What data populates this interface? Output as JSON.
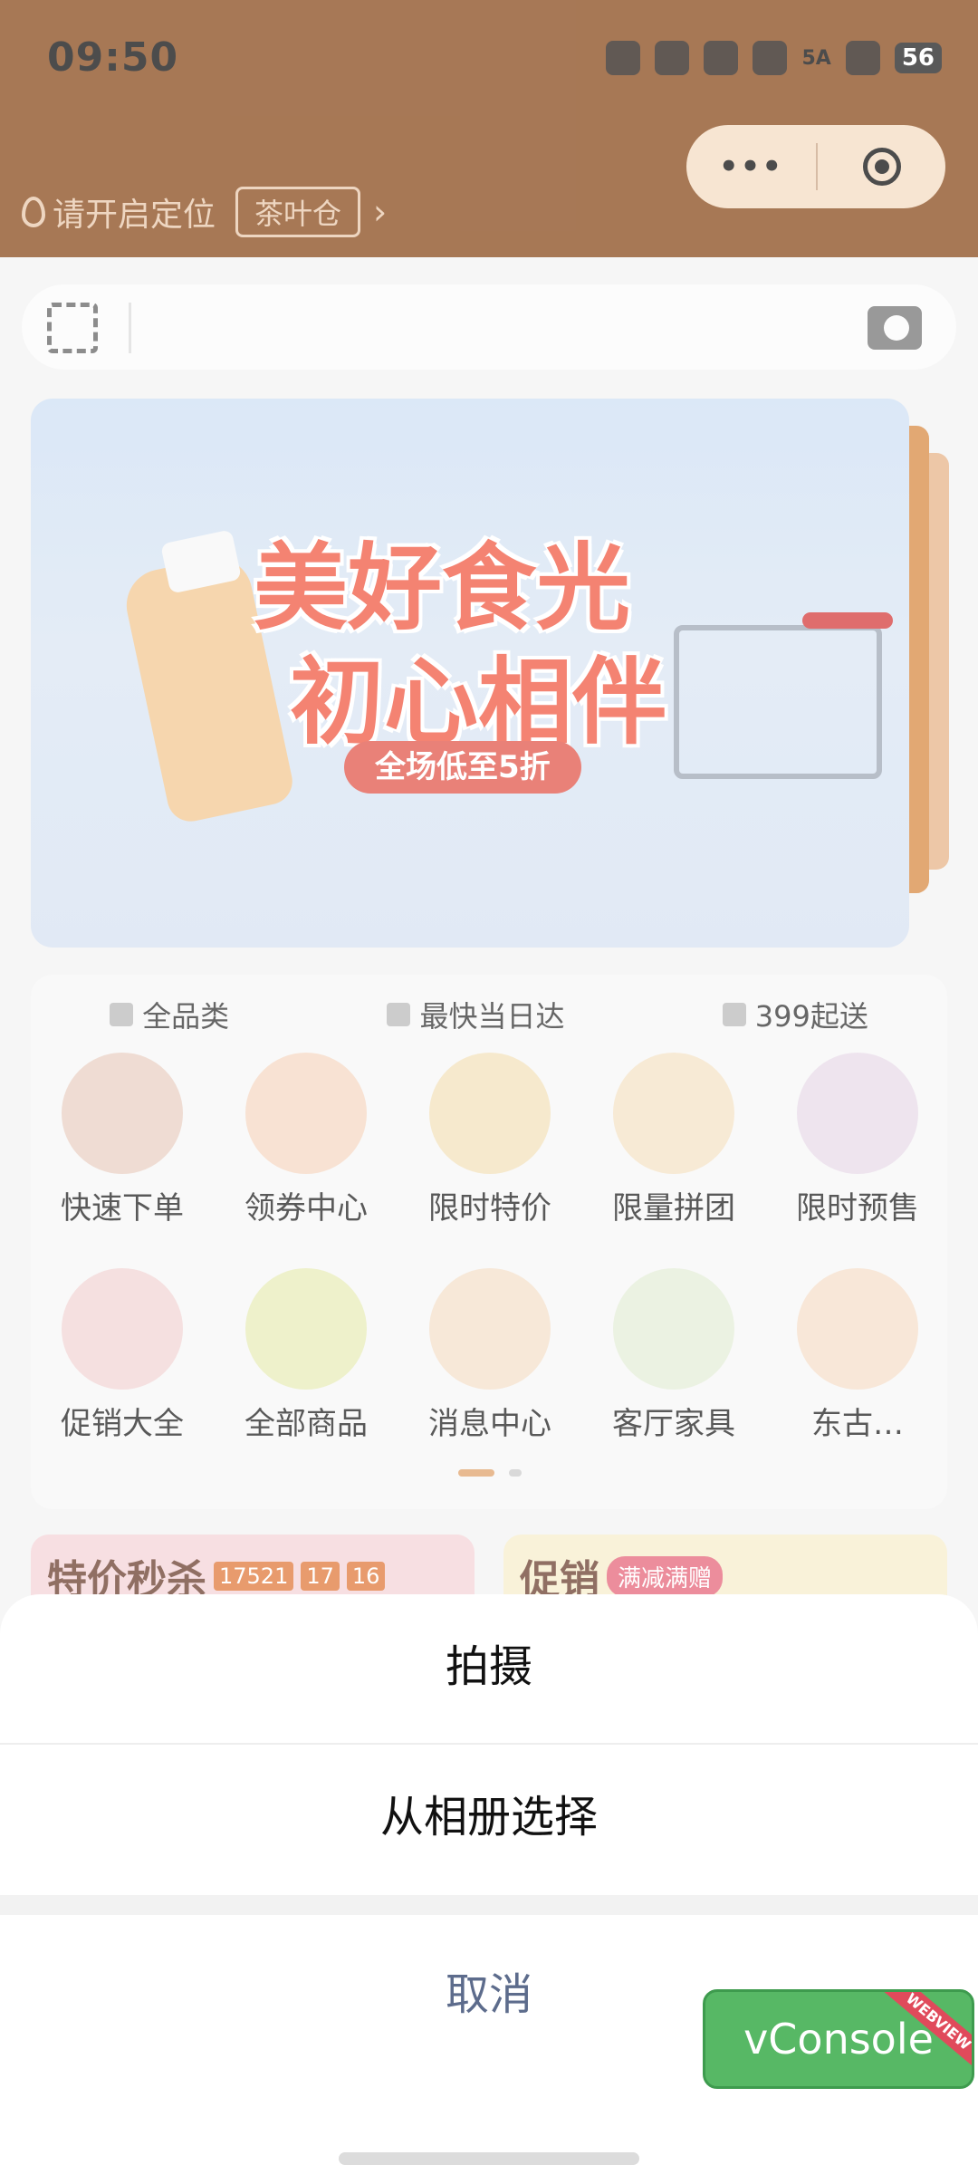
{
  "status_bar": {
    "time": "09:50",
    "network": "5A",
    "battery": "56"
  },
  "header": {
    "location_text": "请开启定位",
    "store_tag": "茶叶仓",
    "capsule_more": "•••",
    "chevron": "›"
  },
  "banner": {
    "line1": "美好食光",
    "line2": "初心相伴",
    "pill": "全场低至5折"
  },
  "features": [
    {
      "label": "全品类",
      "icon": "grid-icon"
    },
    {
      "label": "最快当日达",
      "icon": "rocket-icon"
    },
    {
      "label": "399起送",
      "icon": "truck-icon"
    }
  ],
  "grid_items": [
    {
      "label": "快速下单",
      "color": "#ead1c4"
    },
    {
      "label": "领券中心",
      "color": "#f6d9c5"
    },
    {
      "label": "限时特价",
      "color": "#f3e2bd"
    },
    {
      "label": "限量拼团",
      "color": "#f5e3c7"
    },
    {
      "label": "限时预售",
      "color": "#e8dbe9"
    },
    {
      "label": "促销大全",
      "color": "#f2d6d6"
    },
    {
      "label": "全部商品",
      "color": "#e8ecba"
    },
    {
      "label": "消息中心",
      "color": "#f4e0cb"
    },
    {
      "label": "客厅家具",
      "color": "#e5eed9"
    },
    {
      "label": "东古…",
      "color": "#f6dfcb"
    }
  ],
  "promo": {
    "left_title": "特价秒杀",
    "left_chips": [
      "17521",
      "17",
      "16"
    ],
    "right_title": "促销",
    "right_chip": "满减满赠"
  },
  "action_sheet": {
    "option1": "拍摄",
    "option2": "从相册选择",
    "cancel": "取消"
  },
  "vconsole": {
    "label": "vConsole",
    "ribbon": "WEBVIEW"
  }
}
